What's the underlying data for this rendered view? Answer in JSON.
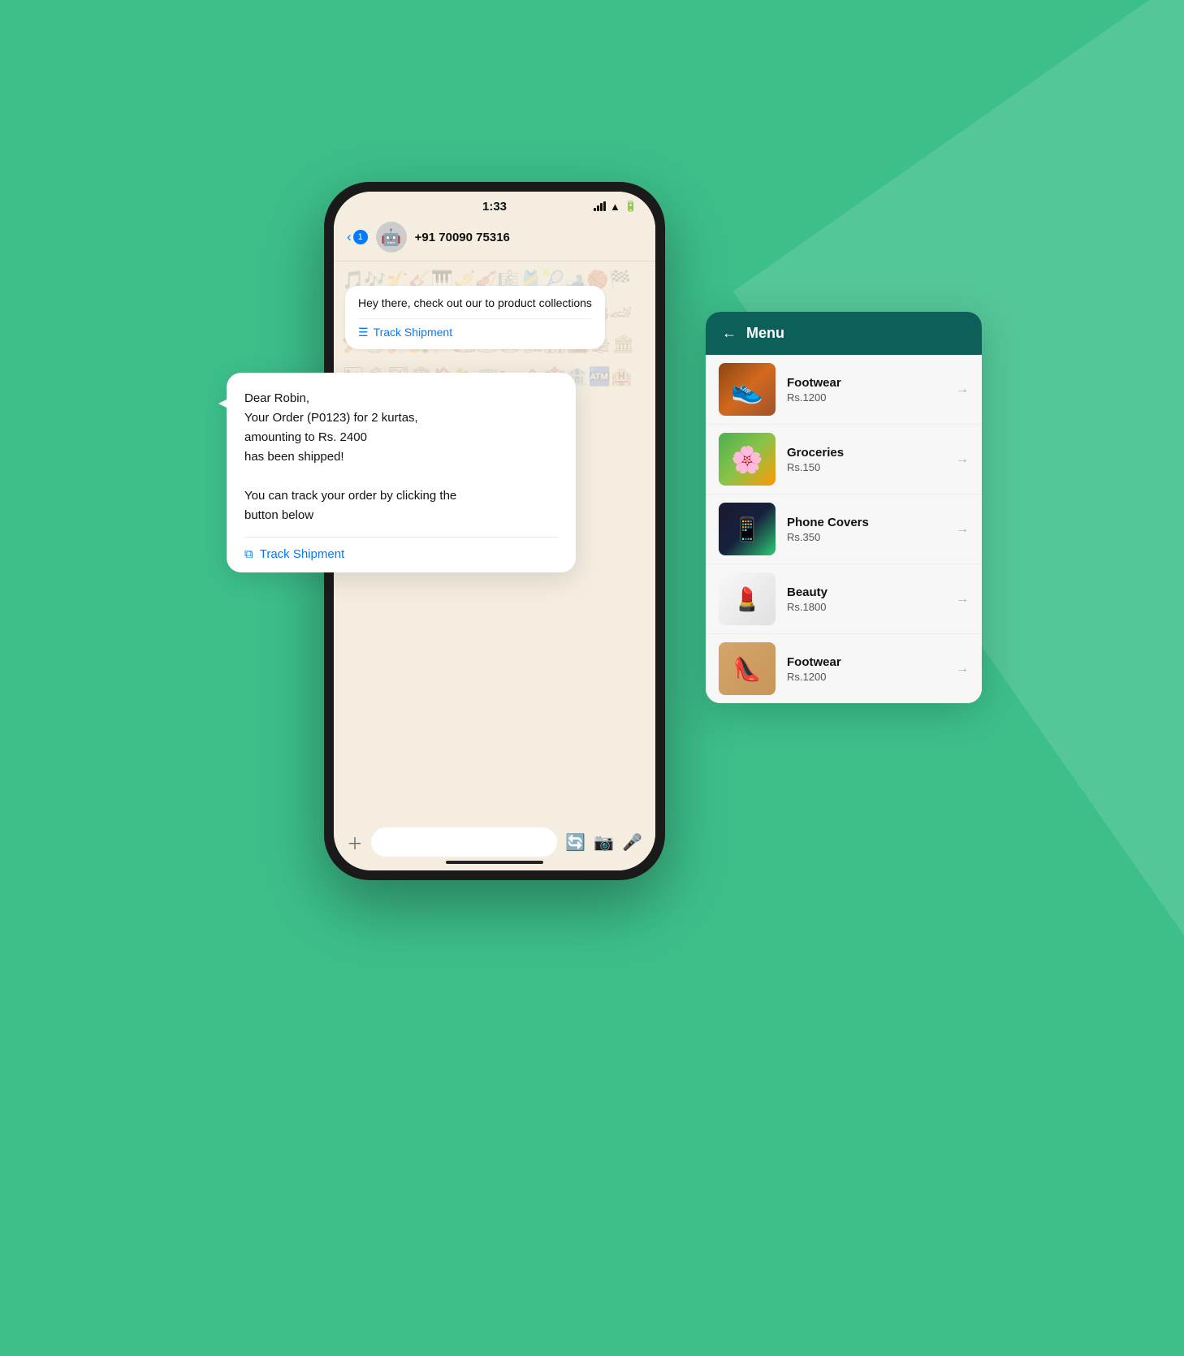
{
  "background": {
    "color": "#3dbf8a"
  },
  "phone": {
    "status_bar": {
      "time": "1:33",
      "signal": "signal",
      "wifi": "wifi",
      "battery": "battery"
    },
    "nav": {
      "back_label": "< 1",
      "avatar_icon": "🤖",
      "phone_number": "+91 70090 75316"
    },
    "bubble1": {
      "text": "Hey there, check out our to product collections",
      "link_label": "Track Shipment"
    },
    "bubble2": {
      "text": "Dear Robin,\nYour Order (P0123) for 2 kurtas, amounting to Rs. 2400\nhas been shipped!\n\nYou can track your order by clicking the button below",
      "link_label": "Track Shipment"
    },
    "input_placeholder": "",
    "bottom_icons": [
      "➕",
      "🔄",
      "📷",
      "🎤"
    ]
  },
  "menu": {
    "title": "Menu",
    "back_icon": "←",
    "items": [
      {
        "name": "Footwear",
        "price": "Rs.1200",
        "img_class": "img-footwear"
      },
      {
        "name": "Groceries",
        "price": "Rs.150",
        "img_class": "img-groceries"
      },
      {
        "name": "Phone Covers",
        "price": "Rs.350",
        "img_class": "img-phone-covers"
      },
      {
        "name": "Beauty",
        "price": "Rs.1800",
        "img_class": "img-beauty"
      },
      {
        "name": "Footwear",
        "price": "Rs.1200",
        "img_class": "img-footwear2"
      }
    ]
  }
}
